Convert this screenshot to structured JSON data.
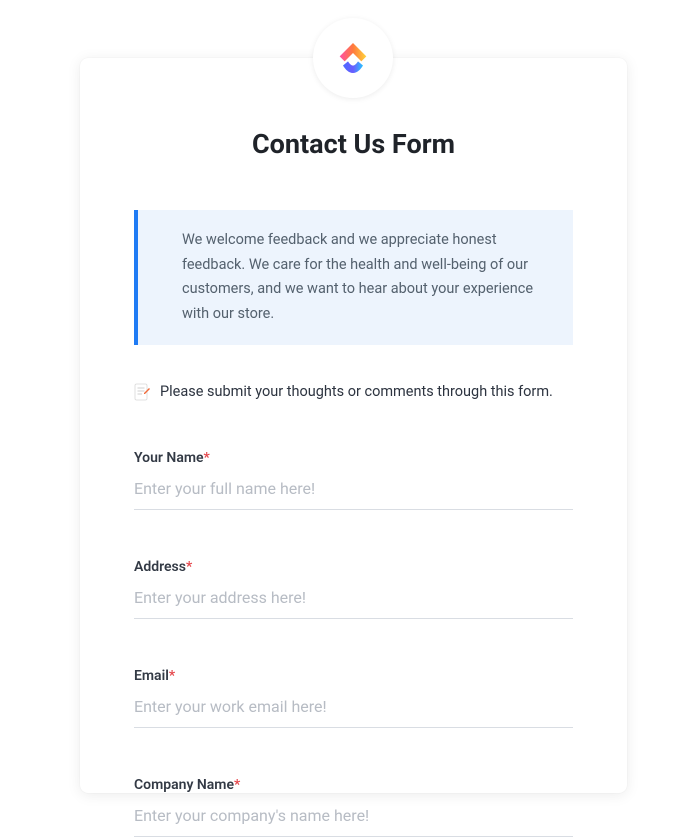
{
  "title": "Contact Us Form",
  "banner": "We welcome feedback and we appreciate honest feedback. We care for the health and well-being of our customers, and we want to hear about your experience with our store.",
  "instruction": "Please submit your thoughts or comments through this form.",
  "fields": {
    "name": {
      "label": "Your Name",
      "required": "*",
      "placeholder": "Enter your full name here!"
    },
    "address": {
      "label": "Address",
      "required": "*",
      "placeholder": "Enter your address here!"
    },
    "email": {
      "label": "Email",
      "required": "*",
      "placeholder": "Enter your work email here!"
    },
    "company": {
      "label": "Company Name",
      "required": "*",
      "placeholder": "Enter your company's name here!"
    }
  }
}
